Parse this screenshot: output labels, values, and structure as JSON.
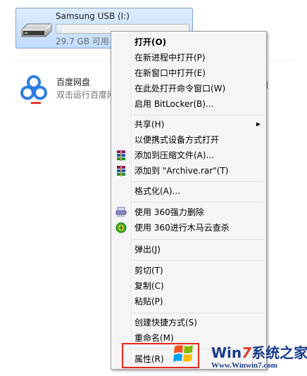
{
  "drive": {
    "name": "Samsung USB (I:)",
    "free_text": "29.7 GB 可用",
    "used_fraction": 0.04,
    "icon": "usb-drive-icon"
  },
  "baidu": {
    "name": "百度网盘",
    "subtitle": "双击运行百度网",
    "icon": "baidu-netdisk-icon"
  },
  "menu": {
    "open": "打开(O)",
    "open_new_process": "在新进程中打开(P)",
    "open_new_window": "在新窗口中打开(E)",
    "open_cmd_here": "在此处打开命令窗口(W)",
    "bitlocker": "启用 BitLocker(B)...",
    "share": "共享(H)",
    "portable_open": "以便携式设备方式打开",
    "add_archive": "添加到压缩文件(A)...",
    "add_archive_rar": "添加到 \"Archive.rar\"(T)",
    "format": "格式化(A)...",
    "shred_360": "使用 360强力删除",
    "trojan_360": "使用 360进行木马云查杀",
    "eject": "弹出(J)",
    "cut": "剪切(T)",
    "copy": "复制(C)",
    "paste": "粘贴(P)",
    "create_shortcut": "创建快捷方式(S)",
    "rename": "重命名(M)",
    "properties": "属性(R)"
  },
  "watermark": {
    "title_prefix": "Win",
    "title_seven": "7",
    "title_suffix": "系统之家",
    "url": "Www.Winwin7.com"
  },
  "colors": {
    "selection_bg": "#c1dcfc",
    "selection_border": "#7da2ce",
    "highlight_border": "#e8261c",
    "menu_bg": "#f5f5f5"
  }
}
